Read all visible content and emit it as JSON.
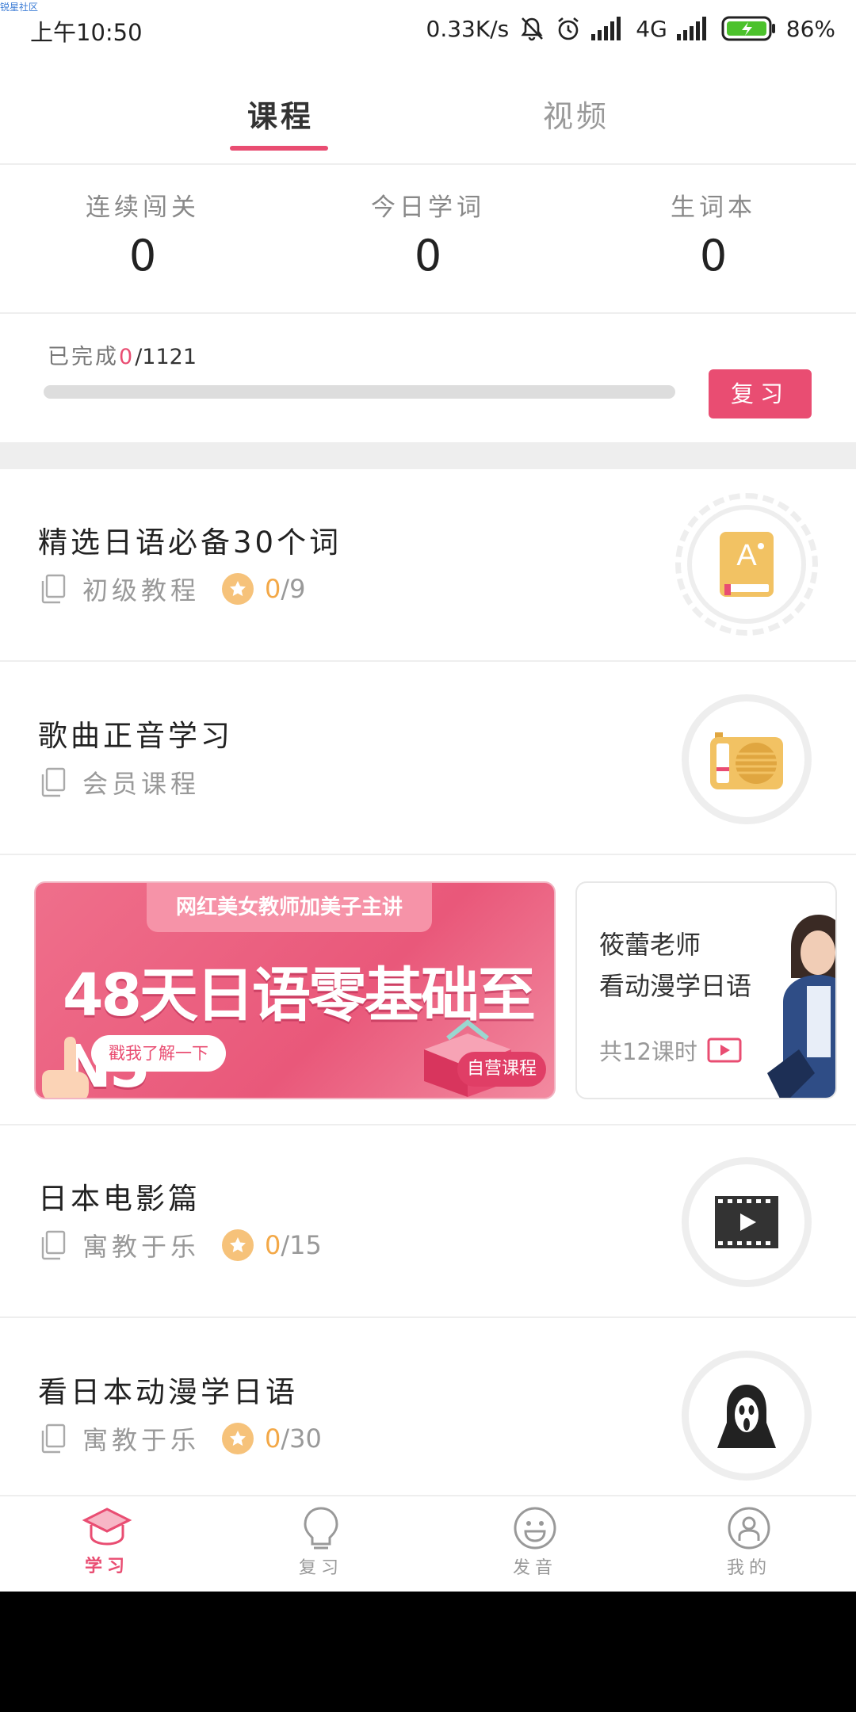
{
  "watermark": "锐星社区",
  "status": {
    "time": "上午10:50",
    "speed": "0.33K/s",
    "network": "4G",
    "battery": "86%"
  },
  "tabs": [
    {
      "label": "课程",
      "active": true
    },
    {
      "label": "视频",
      "active": false
    }
  ],
  "stats": [
    {
      "label": "连续闯关",
      "value": "0"
    },
    {
      "label": "今日学词",
      "value": "0"
    },
    {
      "label": "生词本",
      "value": "0"
    }
  ],
  "progress": {
    "prefix": "已完成",
    "done": "0",
    "total": "/1121",
    "fraction": 0,
    "review_label": "复习"
  },
  "courses": [
    {
      "title": "精选日语必备30个词",
      "type": "初级教程",
      "done": "0",
      "total": "/9",
      "icon": "book-a-icon"
    },
    {
      "title": "歌曲正音学习",
      "type": "会员课程",
      "icon": "radio-icon"
    },
    {
      "title": "日本电影篇",
      "type": "寓教于乐",
      "done": "0",
      "total": "/15",
      "icon": "film-play-icon"
    },
    {
      "title": "看日本动漫学日语",
      "type": "寓教于乐",
      "done": "0",
      "total": "/30",
      "icon": "scream-mask-icon"
    }
  ],
  "banner_main": {
    "top_label": "网红美女教师加美子主讲",
    "headline": "48天日语零基础至N5",
    "cta": "戳我了解一下",
    "tag": "自营课程"
  },
  "banner_side": {
    "line1": "筱蕾老师",
    "line2": "看动漫学日语",
    "lessons": "共12课时"
  },
  "bottom_nav": [
    {
      "label": "学习",
      "icon": "graduation-cap-icon",
      "active": true
    },
    {
      "label": "复习",
      "icon": "lightbulb-icon",
      "active": false
    },
    {
      "label": "发音",
      "icon": "smile-icon",
      "active": false
    },
    {
      "label": "我的",
      "icon": "user-icon",
      "active": false
    }
  ],
  "colors": {
    "accent": "#e94d72",
    "star": "#f6c27a",
    "count": "#f3a847"
  }
}
